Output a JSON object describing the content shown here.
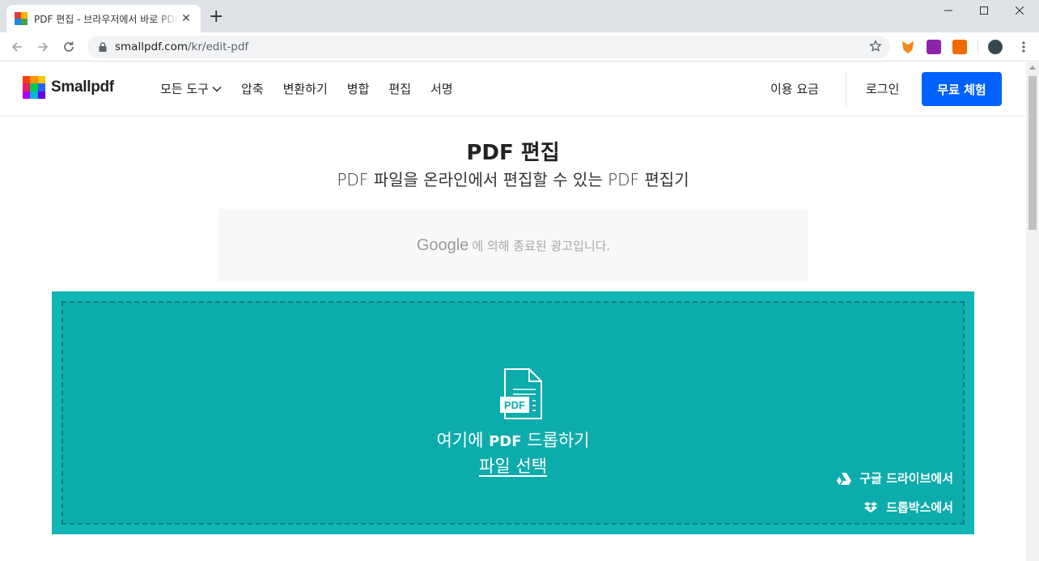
{
  "browser": {
    "tab_title": "PDF 편집 - 브라우저에서 바로 PDF 편집",
    "url_domain": "smallpdf.com",
    "url_path": "/kr/edit-pdf"
  },
  "header": {
    "logo_text": "Smallpdf",
    "nav": [
      "모든 도구",
      "압축",
      "변환하기",
      "병합",
      "편집",
      "서명"
    ],
    "pricing": "이용 요금",
    "login": "로그인",
    "trial": "무료 체험"
  },
  "main": {
    "title": "PDF 편집",
    "subtitle": "PDF 파일을 온라인에서 편집할 수 있는 PDF 편집기",
    "ad_brand": "Google",
    "ad_text": "에 의해 종료된 광고입니다.",
    "drop_prefix": "여기에 ",
    "drop_pdf": "PDF",
    "drop_suffix": " 드롭하기",
    "choose_file": "파일 선택",
    "pdf_icon_label": "PDF",
    "google_drive": "구글 드라이브에서",
    "dropbox": "드롭박스에서"
  },
  "colors": {
    "accent": "#0061fe",
    "dropzone": "#10b5b5"
  }
}
